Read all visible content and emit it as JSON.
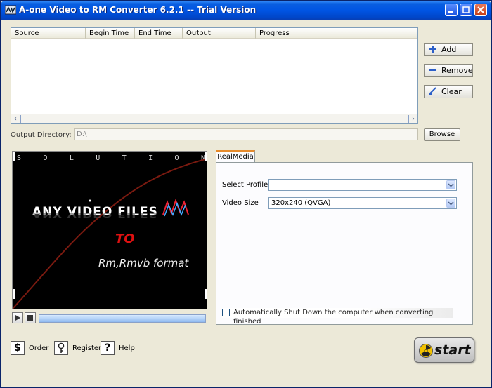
{
  "window": {
    "title": "A-one Video to RM Converter 6.2.1 -- Trial Version"
  },
  "file_list": {
    "columns": [
      "Source",
      "Begin Time",
      "End Time",
      "Output",
      "Progress"
    ]
  },
  "side_buttons": {
    "add": "Add",
    "remove": "Remove",
    "clear": "Clear"
  },
  "output_directory": {
    "label": "Output Directory:",
    "value": "D:\\",
    "browse": "Browse"
  },
  "preview": {
    "banner_top": [
      "S",
      "O",
      "L",
      "U",
      "T",
      "I",
      "O",
      "N"
    ],
    "headline": "ANY VIDEO FILES",
    "to": "TO",
    "format": "Rm,Rmvb format"
  },
  "tabs": {
    "active": "RealMedia"
  },
  "settings": {
    "profile_label": "Select Profile:",
    "profile_value": "",
    "video_size_label": "Video Size",
    "video_size_value": "320x240 (QVGA)",
    "shutdown_label": "Automatically Shut Down the computer when converting finished",
    "shutdown_checked": false
  },
  "bottom": {
    "order": "Order",
    "register": "Register",
    "help": "Help",
    "start": "start"
  },
  "icons": {
    "order": "dollar-icon",
    "register": "key-icon",
    "help": "question-icon",
    "start": "radiation-icon"
  },
  "colors": {
    "titlebar": "#0054e3",
    "tab_accent": "#e68b2c",
    "start_text": "#111111"
  }
}
